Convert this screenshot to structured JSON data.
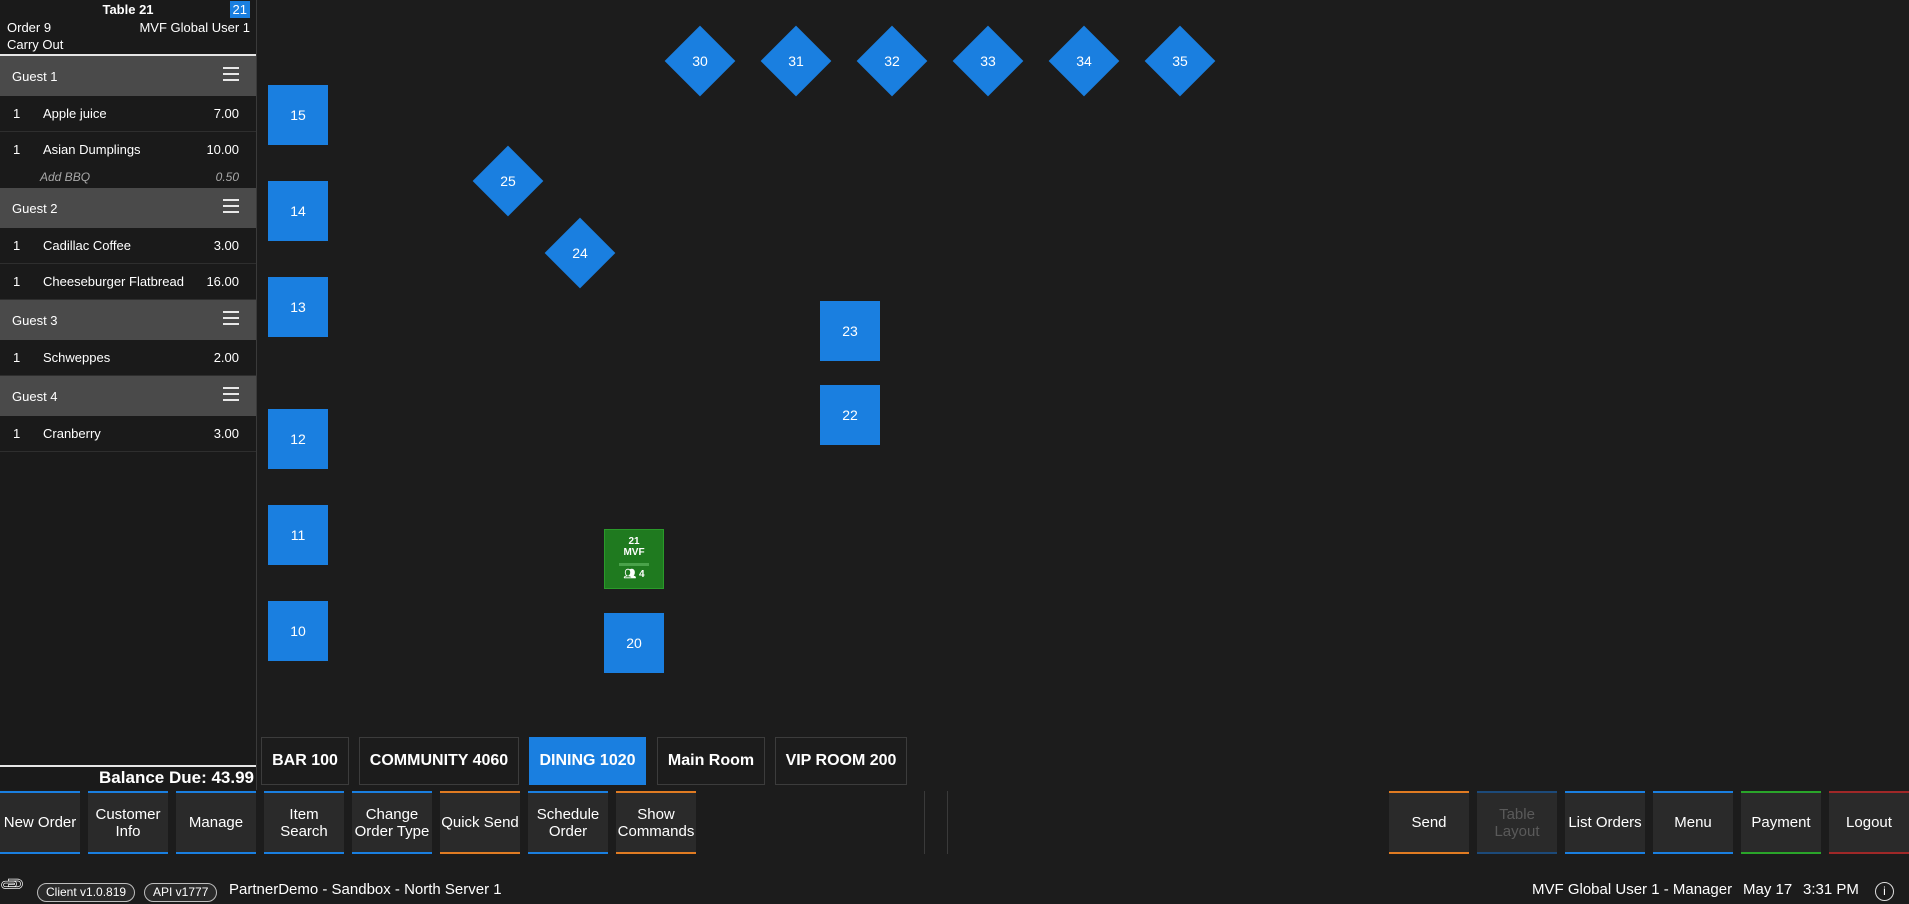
{
  "order": {
    "table_label": "Table 21",
    "table_badge": "21",
    "order_number": "Order 9",
    "user": "MVF Global User 1",
    "order_type": "Carry Out",
    "guests": [
      {
        "name": "Guest 1",
        "items": [
          {
            "qty": "1",
            "name": "Apple juice",
            "price": "7.00"
          },
          {
            "qty": "1",
            "name": "Asian Dumplings",
            "price": "10.00",
            "modifier": {
              "name": "Add BBQ",
              "price": "0.50"
            }
          }
        ]
      },
      {
        "name": "Guest 2",
        "items": [
          {
            "qty": "1",
            "name": "Cadillac Coffee",
            "price": "3.00"
          },
          {
            "qty": "1",
            "name": "Cheeseburger Flatbread",
            "price": "16.00"
          }
        ]
      },
      {
        "name": "Guest 3",
        "items": [
          {
            "qty": "1",
            "name": "Schweppes",
            "price": "2.00"
          }
        ]
      },
      {
        "name": "Guest 4",
        "items": [
          {
            "qty": "1",
            "name": "Cranberry",
            "price": "3.00"
          }
        ]
      }
    ],
    "balance_due": "Balance Due: 43.99"
  },
  "floor": {
    "tables": [
      "15",
      "14",
      "13",
      "12",
      "11",
      "10",
      "20",
      "22",
      "23",
      "24",
      "25",
      "30",
      "31",
      "32",
      "33",
      "34",
      "35"
    ],
    "occupied_table": {
      "number": "21",
      "server": "MVF",
      "guests": "4"
    }
  },
  "rooms": [
    "BAR 100",
    "COMMUNITY 4060",
    "DINING 1020",
    "Main Room",
    "VIP ROOM 200"
  ],
  "active_room": "DINING 1020",
  "commands": {
    "new_order": "New Order",
    "customer_info_1": "Customer",
    "customer_info_2": "Info",
    "manage": "Manage",
    "item_search_1": "Item",
    "item_search_2": "Search",
    "change_order_type_1": "Change",
    "change_order_type_2": "Order Type",
    "quick_send": "Quick Send",
    "schedule_order_1": "Schedule",
    "schedule_order_2": "Order",
    "show_commands_1": "Show",
    "show_commands_2": "Commands",
    "send": "Send",
    "table_layout_1": "Table",
    "table_layout_2": "Layout",
    "list_orders": "List Orders",
    "menu": "Menu",
    "payment": "Payment",
    "logout": "Logout"
  },
  "status": {
    "client_version": "Client v1.0.819",
    "api_version": "API v1777",
    "server": "PartnerDemo - Sandbox - North Server 1",
    "user_role": "MVF Global User 1 - Manager",
    "date": "May 17",
    "time": "3:31 PM"
  },
  "colors": {
    "accent": "#1a7fe0",
    "occupied": "#1f7a1f",
    "orange": "#e07b22",
    "green": "#2aa52a",
    "red": "#a02828",
    "background": "#1c1c1c"
  },
  "icons": {
    "guest_menu": "hamburger-icon",
    "attachment": "paperclip-icon",
    "guests": "people-icon",
    "info": "info-icon"
  }
}
